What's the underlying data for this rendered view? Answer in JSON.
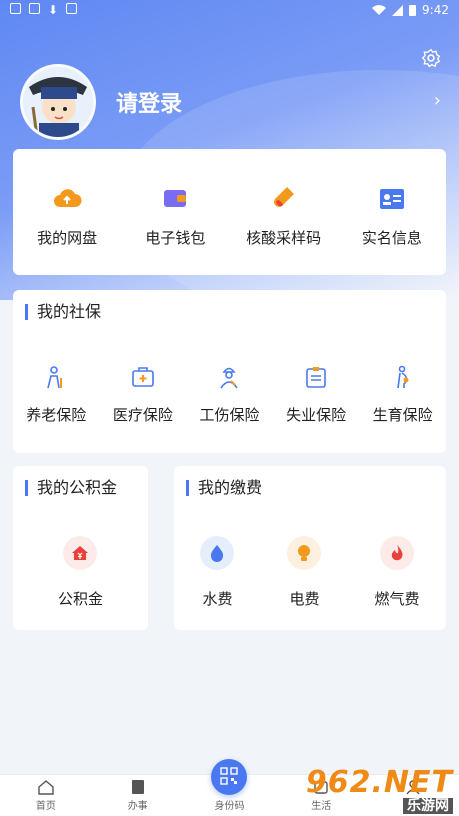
{
  "status": {
    "time": "9:42"
  },
  "profile": {
    "login_text": "请登录"
  },
  "quick_links": [
    {
      "label": "我的网盘",
      "icon": "cloud-upload-icon",
      "color": "#f39a1e"
    },
    {
      "label": "电子钱包",
      "icon": "wallet-icon",
      "color": "#7a6cf0"
    },
    {
      "label": "核酸采样码",
      "icon": "test-tube-icon",
      "color": "#f39a1e"
    },
    {
      "label": "实名信息",
      "icon": "id-card-icon",
      "color": "#4a78f0"
    }
  ],
  "social": {
    "title": "我的社保",
    "items": [
      {
        "label": "养老保险",
        "icon": "elderly-person-icon"
      },
      {
        "label": "医疗保险",
        "icon": "medical-kit-icon"
      },
      {
        "label": "工伤保险",
        "icon": "injured-worker-icon"
      },
      {
        "label": "失业保险",
        "icon": "clipboard-icon"
      },
      {
        "label": "生育保险",
        "icon": "pregnant-woman-icon"
      }
    ]
  },
  "fund": {
    "title": "我的公积金",
    "items": [
      {
        "label": "公积金",
        "icon": "house-yuan-icon",
        "color": "#e8413a"
      }
    ]
  },
  "payment": {
    "title": "我的缴费",
    "items": [
      {
        "label": "水费",
        "icon": "water-drop-icon",
        "color": "#4a78f0"
      },
      {
        "label": "电费",
        "icon": "light-bulb-icon",
        "color": "#f39a1e"
      },
      {
        "label": "燃气费",
        "icon": "flame-icon",
        "color": "#e8413a"
      }
    ]
  },
  "tabbar": [
    {
      "label": "首页",
      "icon": "home-icon"
    },
    {
      "label": "办事",
      "icon": "document-icon"
    },
    {
      "label": "身份码",
      "icon": "qr-code-icon"
    },
    {
      "label": "生活",
      "icon": "life-icon"
    },
    {
      "label": "我的",
      "icon": "person-icon"
    }
  ],
  "watermark": {
    "brand": "962.NET",
    "subtitle": "乐游网"
  }
}
